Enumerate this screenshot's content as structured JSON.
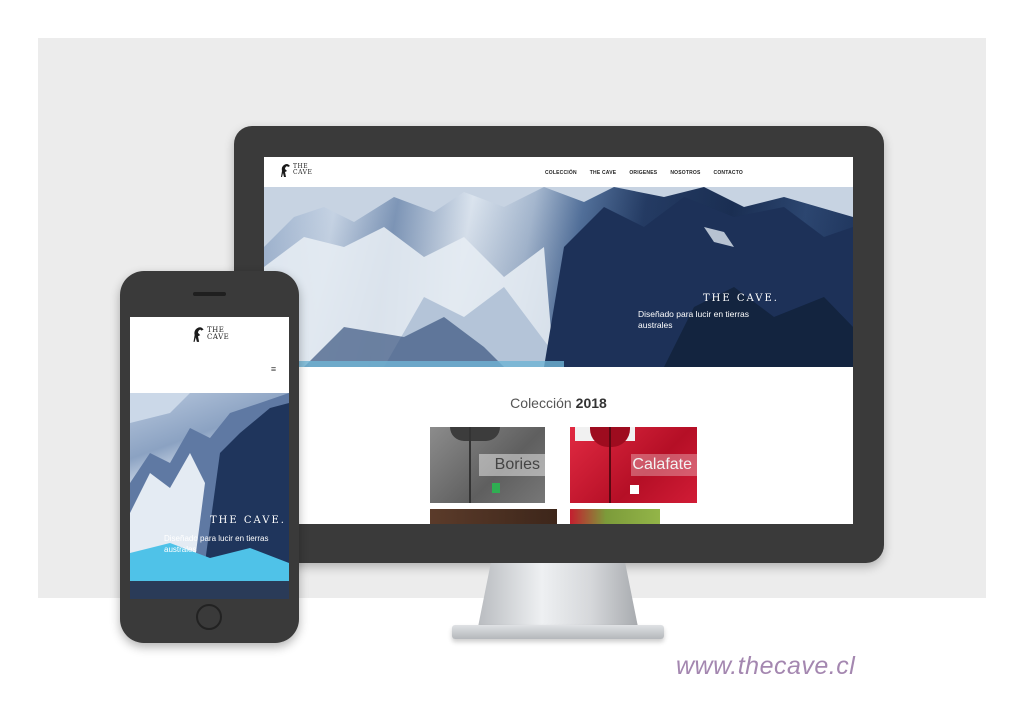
{
  "desktop": {
    "logo_text": "THE\nCAVE",
    "nav": [
      "COLECCIÓN",
      "THE CAVE",
      "ORIGENES",
      "NOSOTROS",
      "CONTACTO"
    ],
    "hero": {
      "brand": "THE CAVE.",
      "tagline": "Diseñado para lucir en tierras australes"
    },
    "collection": {
      "label": "Colección",
      "year": "2018",
      "products": [
        {
          "name": "Bories",
          "color": "#7a7a7a"
        },
        {
          "name": "Calafate",
          "color": "#c8142c"
        }
      ]
    }
  },
  "mobile": {
    "logo_text": "THE\nCAVE",
    "menu_icon": "hamburger-menu-icon",
    "hero": {
      "brand": "THE CAVE.",
      "tagline": "Diseñado para lucir en tierras australes"
    }
  },
  "footer": {
    "url": "www.thecave.cl"
  },
  "colors": {
    "url_text": "#a487b0",
    "device_frame": "#3a3a3a",
    "backdrop": "#ececec"
  }
}
